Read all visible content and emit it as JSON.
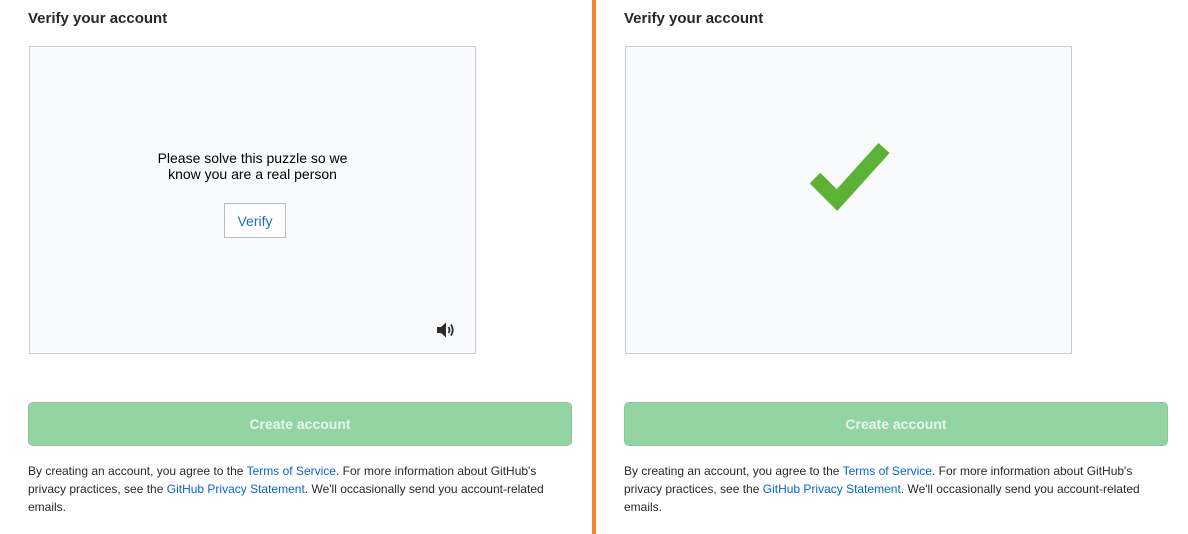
{
  "left_panel": {
    "title": "Verify your account",
    "captcha": {
      "prompt": "Please solve this puzzle so we\nknow you are a real person",
      "verify_label": "Verify",
      "audio_icon": "speaker-icon"
    },
    "create_button_label": "Create account",
    "legal": {
      "prefix": "By creating an account, you agree to the ",
      "terms_link": "Terms of Service",
      "middle": ". For more information about GitHub's privacy practices, see the ",
      "privacy_link": "GitHub Privacy Statement",
      "suffix": ". We'll occasionally send you account-related emails."
    }
  },
  "right_panel": {
    "title": "Verify your account",
    "captcha": {
      "status_icon": "checkmark-icon",
      "status_color": "#5bb235"
    },
    "create_button_label": "Create account",
    "legal": {
      "prefix": "By creating an account, you agree to the ",
      "terms_link": "Terms of Service",
      "middle": ". For more information about GitHub's privacy practices, see the ",
      "privacy_link": "GitHub Privacy Statement",
      "suffix": ". We'll occasionally send you account-related emails."
    }
  },
  "colors": {
    "divider": "#f4852c",
    "create_button_bg": "#94d3a2",
    "link": "#0366d6",
    "verify_text": "#1f6fba"
  }
}
